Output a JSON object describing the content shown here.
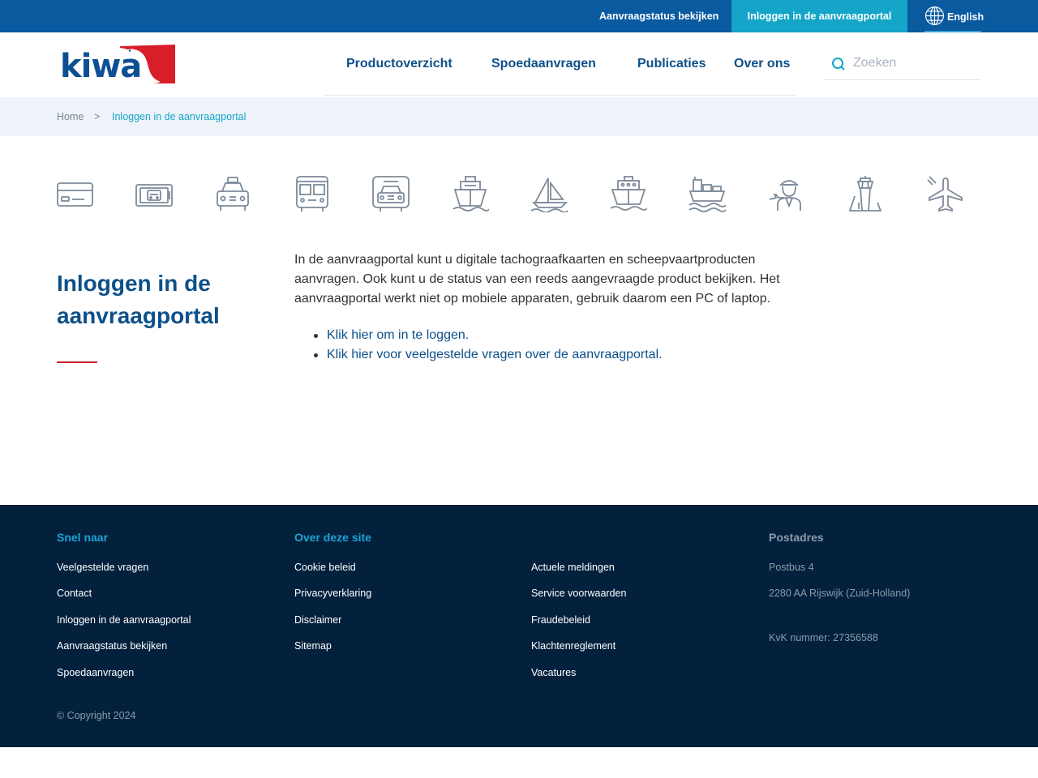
{
  "topbar": {
    "status_link": "Aanvraagstatus bekijken",
    "portal_tab": "Inloggen in de aanvraagportal",
    "language": "English"
  },
  "header": {
    "logo_text": "kiwa",
    "nav": [
      "Productoverzicht",
      "Spoedaanvragen",
      "Publicaties",
      "Over ons"
    ],
    "search_placeholder": "Zoeken"
  },
  "breadcrumb": {
    "home": "Home",
    "separator": ">",
    "current": "Inloggen in de aanvraagportal"
  },
  "product_icons": [
    "credit-card-icon",
    "tachograph-icon",
    "taxi-icon",
    "bus-icon",
    "truck-icon",
    "ship-icon",
    "sailboat-icon",
    "ferry-icon",
    "cargo-ship-icon",
    "pilot-icon",
    "control-tower-icon",
    "airplane-icon"
  ],
  "main": {
    "title": "Inloggen in de aanvraagportal",
    "intro": "In de aanvraagportal kunt u digitale tachograafkaarten en scheepvaartproducten aanvragen. Ook kunt u de status van een reeds aangevraagde product bekijken. Het aanvraagportal werkt niet op mobiele apparaten, gebruik daarom een PC of laptop.",
    "links": [
      "Klik hier om in te loggen.",
      "Klik hier voor veelgestelde vragen over de aanvraagportal."
    ]
  },
  "footer": {
    "quick_heading": "Snel naar",
    "quick_links": [
      "Veelgestelde vragen",
      "Contact",
      "Inloggen in de aanvraagportal",
      "Aanvraagstatus bekijken",
      "Spoedaanvragen"
    ],
    "site_heading": "Over deze site",
    "site_links_a": [
      "Cookie beleid",
      "Privacyverklaring",
      "Disclaimer",
      "Sitemap"
    ],
    "site_links_b": [
      "Actuele meldingen",
      "Service voorwaarden",
      "Fraudebeleid",
      "Klachtenreglement",
      "Vacatures"
    ],
    "postal_heading": "Postadres",
    "postal_lines": [
      "Postbus 4",
      "2280 AA Rijswijk (Zuid-Holland)",
      "KvK nummer: 27356588"
    ],
    "copyright": "© Copyright 2024"
  },
  "colors": {
    "topbar": "#0a5aa0",
    "accent": "#14a5c8",
    "brand_blue": "#0d5089",
    "brand_red": "#c8202f",
    "footer": "#03213d"
  }
}
